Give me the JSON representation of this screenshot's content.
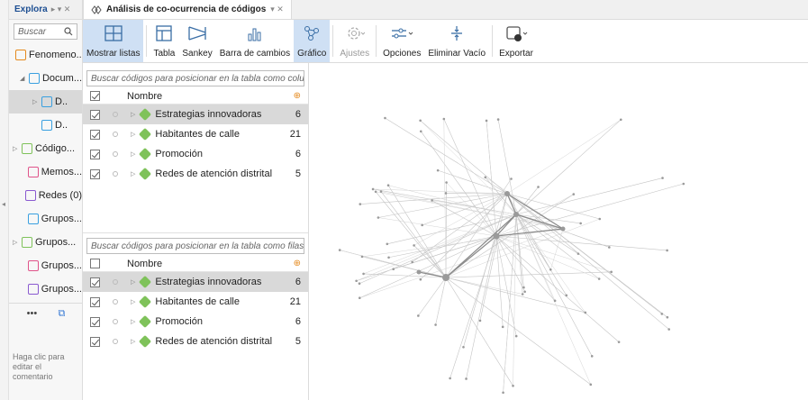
{
  "explorer": {
    "tab_title": "Explora",
    "tab_controls": "▸ ▾ ✕",
    "search_placeholder": "Buscar",
    "items": [
      {
        "label": "Fenomeno...",
        "color": "#e58a1f",
        "indent": 0
      },
      {
        "label": "Docum...",
        "color": "#3aa0e0",
        "indent": 8
      },
      {
        "label": "D..",
        "color": "#3aa0e0",
        "indent": 22
      },
      {
        "label": "D..",
        "color": "#3aa0e0",
        "indent": 22
      },
      {
        "label": "Código...",
        "color": "#7fc25a",
        "indent": 0
      },
      {
        "label": "Memos...",
        "color": "#e0548a",
        "indent": 8
      },
      {
        "label": "Redes (0)",
        "color": "#8a5ad0",
        "indent": 8
      },
      {
        "label": "Grupos...",
        "color": "#3aa0e0",
        "indent": 8
      },
      {
        "label": "Grupos...",
        "color": "#7fc25a",
        "indent": 0
      },
      {
        "label": "Grupos...",
        "color": "#e0548a",
        "indent": 8
      },
      {
        "label": "Grupos...",
        "color": "#8a5ad0",
        "indent": 8
      }
    ],
    "comment_hint": "Haga clic para editar el comentario"
  },
  "document": {
    "tab_title": "Análisis de co-ocurrencia de códigos",
    "tab_controls": "▾ ✕"
  },
  "ribbon": {
    "buttons": [
      {
        "label": "Mostrar listas",
        "icon": "layout-icon",
        "active": true
      },
      {
        "label": "Tabla",
        "icon": "table-icon"
      },
      {
        "label": "Sankey",
        "icon": "sankey-icon"
      },
      {
        "label": "Barra de cambios",
        "icon": "bar-chart-icon"
      },
      {
        "label": "Gráfico",
        "icon": "graph-icon",
        "active": true
      },
      {
        "label": "Ajustes",
        "icon": "settings-icon",
        "disabled": true
      },
      {
        "label": "Opciones",
        "icon": "options-icon"
      },
      {
        "label": "Eliminar Vacío",
        "icon": "remove-empty-icon"
      },
      {
        "label": "Exportar",
        "icon": "export-icon"
      }
    ]
  },
  "columns_panel": {
    "search_placeholder": "Buscar códigos para posicionar en la tabla como columnas",
    "header_name": "Nombre",
    "header_count_icon": "frequency-icon",
    "rows": [
      {
        "name": "Estrategias innovadoras",
        "count": "6",
        "selected": true
      },
      {
        "name": "Habitantes de calle",
        "count": "21"
      },
      {
        "name": "Promoción",
        "count": "6"
      },
      {
        "name": "Redes de atención distrital",
        "count": "5"
      }
    ]
  },
  "rows_panel": {
    "search_placeholder": "Buscar códigos para posicionar en la tabla como filas",
    "header_name": "Nombre",
    "header_count_icon": "frequency-icon",
    "rows": [
      {
        "name": "Estrategias innovadoras",
        "count": "6",
        "selected": true
      },
      {
        "name": "Habitantes de calle",
        "count": "21"
      },
      {
        "name": "Promoción",
        "count": "6"
      },
      {
        "name": "Redes de atención distrital",
        "count": "5"
      }
    ]
  },
  "colors": {
    "accent": "#cfe0f4",
    "code_green": "#7fc25a",
    "frequency": "#e58a1f"
  }
}
